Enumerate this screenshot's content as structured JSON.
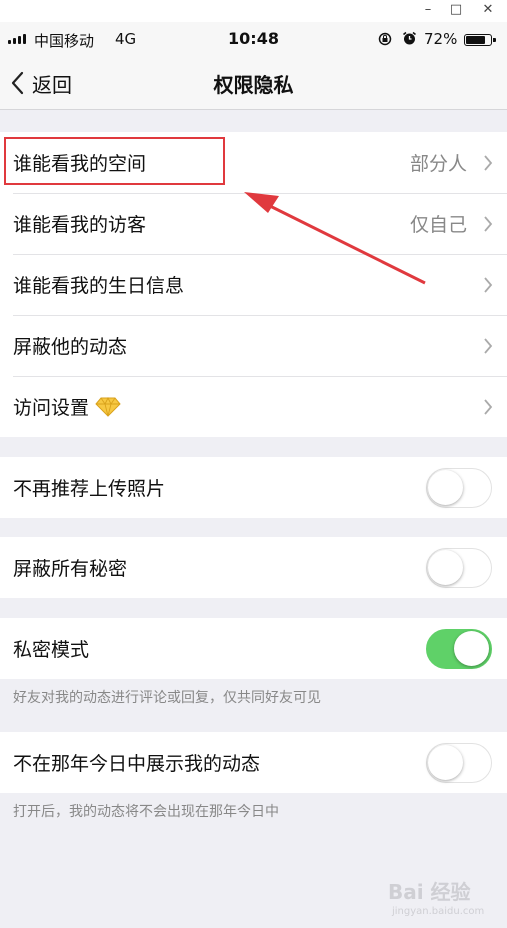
{
  "window": {
    "minimize": "–",
    "maximize": "□",
    "close": "✕"
  },
  "status": {
    "carrier": "中国移动",
    "network": "4G",
    "time": "10:48",
    "battery": "72%",
    "battery_level": 0.72
  },
  "nav": {
    "back_label": "返回",
    "title": "权限隐私"
  },
  "group1": {
    "rows": [
      {
        "label": "谁能看我的空间",
        "value": "部分人"
      },
      {
        "label": "谁能看我的访客",
        "value": "仅自己"
      },
      {
        "label": "谁能看我的生日信息",
        "value": ""
      },
      {
        "label": "屏蔽他的动态",
        "value": ""
      },
      {
        "label": "访问设置",
        "value": "",
        "icon": "diamond-icon"
      }
    ]
  },
  "toggles": [
    {
      "label": "不再推荐上传照片",
      "on": false
    },
    {
      "label": "屏蔽所有秘密",
      "on": false
    },
    {
      "label": "私密模式",
      "on": true,
      "note": "好友对我的动态进行评论或回复，仅共同好友可见"
    },
    {
      "label": "不在那年今日中展示我的动态",
      "on": false,
      "note": "打开后，我的动态将不会出现在那年今日中"
    }
  ],
  "colors": {
    "highlight": "#e0393e",
    "toggle_on": "#5fd168"
  },
  "watermark": {
    "text": "Bai 经验",
    "subtext": "jingyan.baidu.com"
  }
}
